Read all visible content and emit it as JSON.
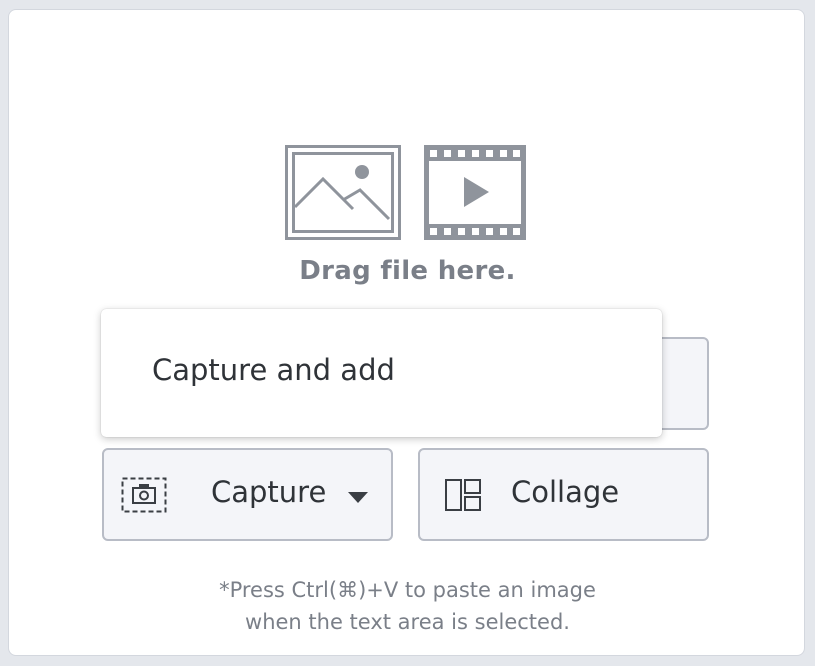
{
  "dropzone": {
    "drag_text": "Drag file here.",
    "icons": [
      "image-icon",
      "video-icon"
    ]
  },
  "buttons": {
    "capture_label": "Capture",
    "collage_label": "Collage"
  },
  "capture_menu": {
    "items": [
      {
        "label": "Capture and add"
      }
    ]
  },
  "hint": {
    "line1": "*Press Ctrl(⌘)+V to paste an image",
    "line2": "when the text area is selected."
  },
  "colors": {
    "icon_gray": "#8f949c",
    "text_gray": "#7a7f88",
    "button_bg": "#f4f5f9",
    "button_border": "#b8bcc6"
  }
}
